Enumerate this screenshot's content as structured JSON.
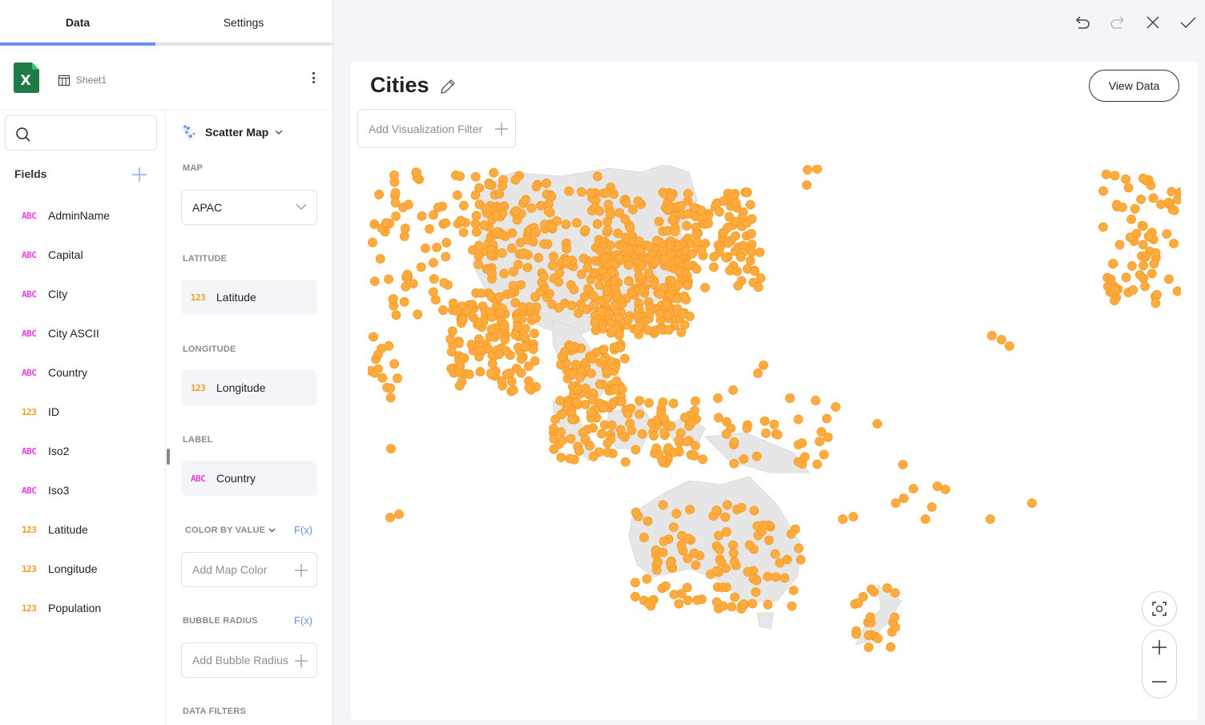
{
  "tabs": [
    {
      "label": "Data",
      "active": true
    },
    {
      "label": "Settings",
      "active": false
    }
  ],
  "datasource": {
    "icon": "excel-icon",
    "sheet": "Sheet1"
  },
  "search": {
    "placeholder": "",
    "value": ""
  },
  "fields": {
    "title": "Fields",
    "items": [
      {
        "type": "ABC",
        "name": "AdminName"
      },
      {
        "type": "ABC",
        "name": "Capital"
      },
      {
        "type": "ABC",
        "name": "City"
      },
      {
        "type": "ABC",
        "name": "City ASCII"
      },
      {
        "type": "ABC",
        "name": "Country"
      },
      {
        "type": "123",
        "name": "ID"
      },
      {
        "type": "ABC",
        "name": "Iso2"
      },
      {
        "type": "ABC",
        "name": "Iso3"
      },
      {
        "type": "123",
        "name": "Latitude"
      },
      {
        "type": "123",
        "name": "Longitude"
      },
      {
        "type": "123",
        "name": "Population"
      }
    ]
  },
  "config": {
    "viz_type": "Scatter Map",
    "map_label": "MAP",
    "map_value": "APAC",
    "latitude_label": "LATITUDE",
    "latitude_field": {
      "type": "123",
      "name": "Latitude"
    },
    "longitude_label": "LONGITUDE",
    "longitude_field": {
      "type": "123",
      "name": "Longitude"
    },
    "label_label": "LABEL",
    "label_field": {
      "type": "ABC",
      "name": "Country"
    },
    "color_label": "COLOR BY VALUE",
    "color_fx": "F(x)",
    "color_placeholder": "Add Map Color",
    "radius_label": "BUBBLE RADIUS",
    "radius_fx": "F(x)",
    "radius_placeholder": "Add Bubble Radius",
    "filters_label": "DATA FILTERS"
  },
  "toolbar": {
    "undo": "undo-icon",
    "redo": "redo-icon",
    "close": "close-icon",
    "confirm": "check-icon"
  },
  "visualization": {
    "title": "Cities",
    "view_data_label": "View Data",
    "filter_placeholder": "Add Visualization Filter",
    "marker_color": "#ffab40",
    "marker_stroke": "#f59a1f",
    "land_color": "#e6e6e6"
  },
  "colors": {
    "accent": "#6a8ff0",
    "abc_type": "#ee3de0",
    "num_type": "#f59a1f"
  }
}
